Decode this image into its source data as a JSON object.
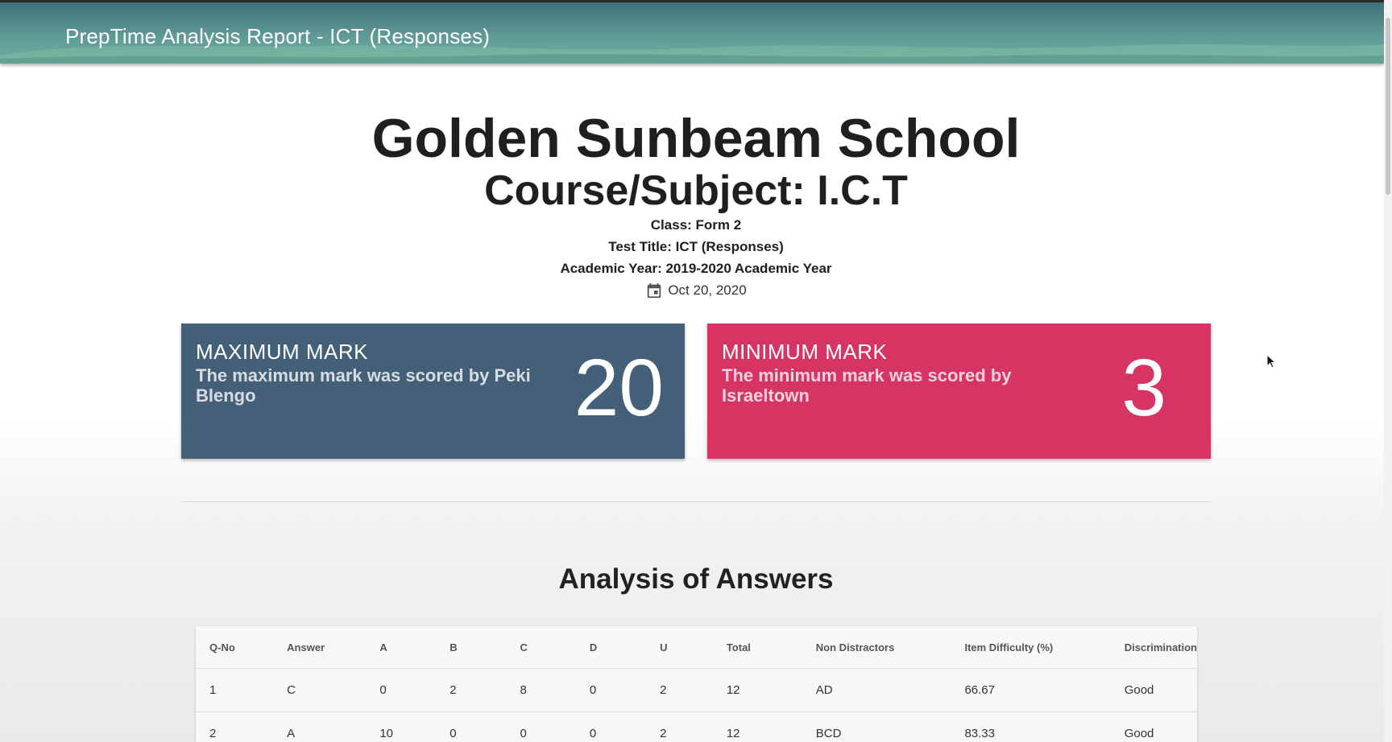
{
  "appbar": {
    "title": "PrepTime Analysis Report - ICT (Responses)"
  },
  "header": {
    "school": "Golden Sunbeam School",
    "course": "Course/Subject: I.C.T",
    "class": "Class: Form 2",
    "test_title": "Test Title: ICT (Responses)",
    "academic_year": "Academic Year: 2019-2020 Academic Year",
    "date": "Oct 20, 2020",
    "date_icon": "calendar-icon"
  },
  "cards": {
    "max": {
      "label": "MAXIMUM MARK",
      "desc": "The maximum mark was scored by Peki Blengo",
      "value": "20",
      "color": "#445f78"
    },
    "min": {
      "label": "MINIMUM MARK",
      "desc": "The minimum mark was scored by Israeltown",
      "value": "3",
      "color": "#d63564"
    }
  },
  "analysis": {
    "title": "Analysis of Answers",
    "columns": [
      "Q-No",
      "Answer",
      "A",
      "B",
      "C",
      "D",
      "U",
      "Total",
      "Non Distractors",
      "Item Difficulty (%)",
      "Discrimination"
    ],
    "rows": [
      [
        "1",
        "C",
        "0",
        "2",
        "8",
        "0",
        "2",
        "12",
        "AD",
        "66.67",
        "Good"
      ],
      [
        "2",
        "A",
        "10",
        "0",
        "0",
        "0",
        "2",
        "12",
        "BCD",
        "83.33",
        "Good"
      ]
    ]
  }
}
